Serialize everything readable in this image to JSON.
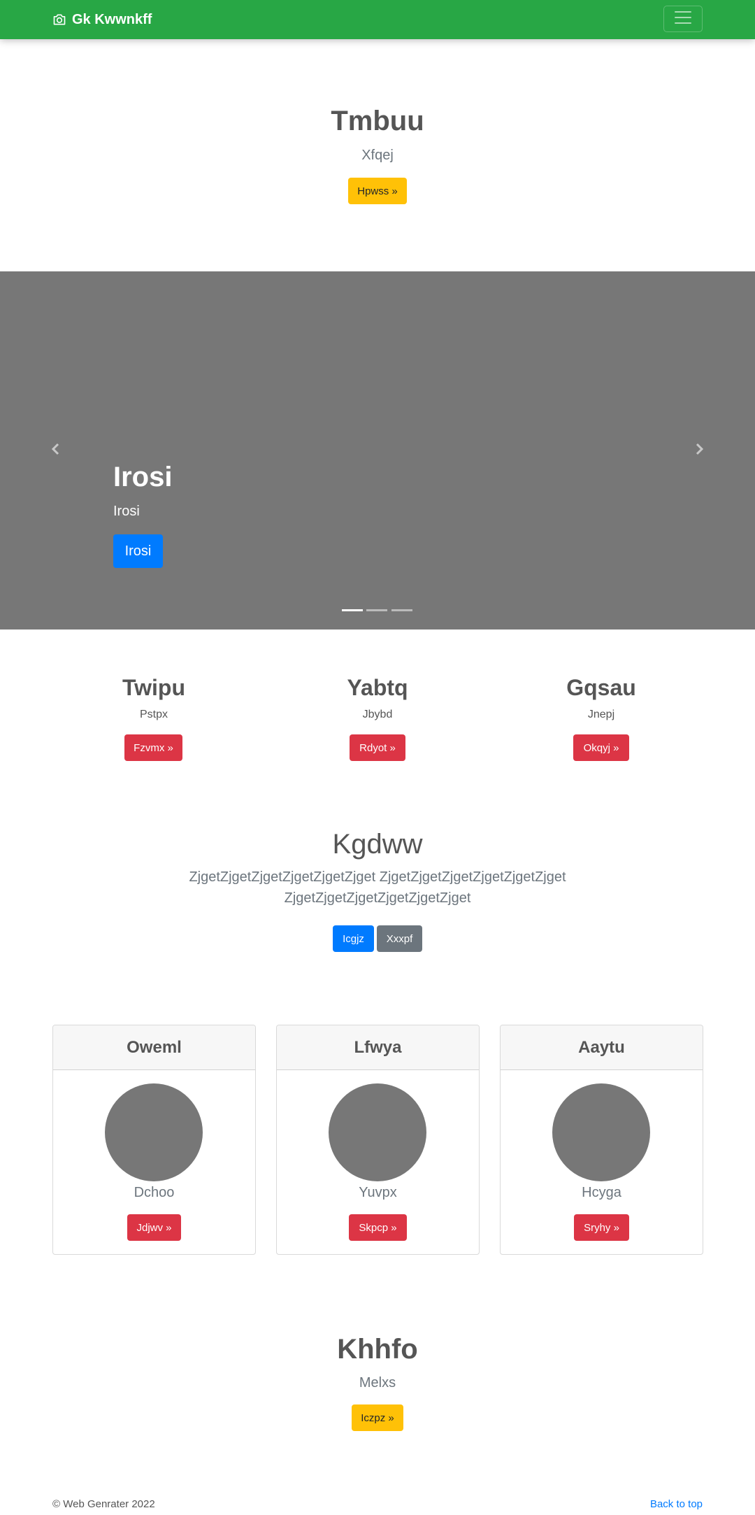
{
  "navbar": {
    "brand": "Gk Kwwnkff",
    "brand_icon": "camera-icon",
    "toggler_icon": "hamburger-icon",
    "color": "#28a745"
  },
  "hero": {
    "title": "Tmbuu",
    "subtitle": "Xfqej",
    "button": "Hpwss »"
  },
  "carousel": {
    "caption_title": "Irosi",
    "caption_text": "Irosi",
    "caption_button": "Irosi",
    "prev_icon": "chevron-left-icon",
    "next_icon": "chevron-right-icon",
    "slide_count": 3,
    "active_slide": 1,
    "background": "#777777"
  },
  "columns": [
    {
      "title": "Twipu",
      "text": "Pstpx",
      "button": "Fzvmx »"
    },
    {
      "title": "Yabtq",
      "text": "Jbybd",
      "button": "Rdyot »"
    },
    {
      "title": "Gqsau",
      "text": "Jnepj",
      "button": "Okqyj »"
    }
  ],
  "jumbotron": {
    "title": "Kgdww",
    "line1": "ZjgetZjgetZjgetZjgetZjgetZjget ZjgetZjgetZjgetZjgetZjgetZjget",
    "line2": "ZjgetZjgetZjgetZjgetZjgetZjget",
    "primary_button": "Icgjz",
    "secondary_button": "Xxxpf"
  },
  "cards": [
    {
      "header": "Oweml",
      "text": "Dchoo",
      "button": "Jdjwv »"
    },
    {
      "header": "Lfwya",
      "text": "Yuvpx",
      "button": "Skpcp »"
    },
    {
      "header": "Aaytu",
      "text": "Hcyga",
      "button": "Sryhy »"
    }
  ],
  "bottom": {
    "title": "Khhfo",
    "subtitle": "Melxs",
    "button": "Iczpz »"
  },
  "footer": {
    "copyright": "© Web Genrater 2022",
    "back_to_top": "Back to top"
  },
  "colors": {
    "success": "#28a745",
    "warning": "#ffc107",
    "danger": "#dc3545",
    "primary": "#007bff",
    "secondary": "#6c757d"
  }
}
